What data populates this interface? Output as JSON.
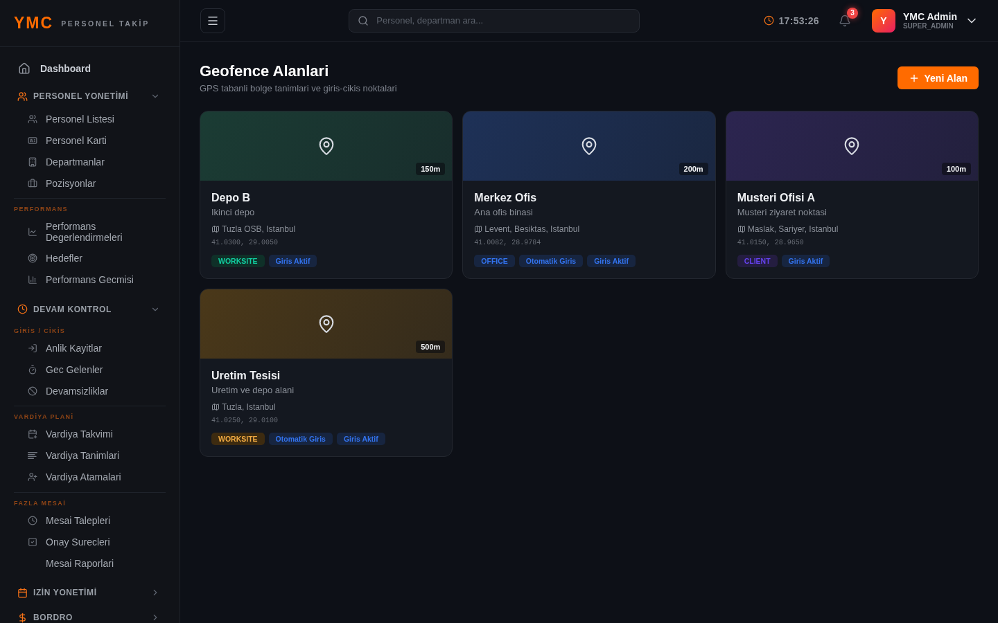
{
  "sidebar": {
    "logo": "YMC",
    "tagline": "PERSONEL TAKİP",
    "nav": [
      {
        "kind": "link",
        "label": "Dashboard"
      },
      {
        "kind": "group",
        "label": "PERSONEL YONETİMİ",
        "expanded": true,
        "sections": [
          {
            "items": [
              "Personel Listesi",
              "Personel Karti",
              "Departmanlar",
              "Pozisyonlar"
            ]
          },
          {
            "title": "PERFORMANS",
            "items": [
              "Performans Degerlendirmeleri",
              "Hedefler",
              "Performans Gecmisi"
            ]
          }
        ]
      },
      {
        "kind": "group",
        "label": "DEVAM KONTROL",
        "expanded": true,
        "sections": [
          {
            "title": "GİRİS / CİKİS",
            "items": [
              "Anlik Kayitlar",
              "Gec Gelenler",
              "Devamsizliklar"
            ]
          },
          {
            "title": "VARDİYA PLANİ",
            "items": [
              "Vardiya Takvimi",
              "Vardiya Tanimlari",
              "Vardiya Atamalari"
            ]
          },
          {
            "title": "FAZLA MESAİ",
            "items": [
              "Mesai Talepleri",
              "Onay Surecleri",
              "Mesai Raporlari"
            ]
          }
        ]
      },
      {
        "kind": "group",
        "label": "IZİN YONETİMİ",
        "expanded": false
      },
      {
        "kind": "group",
        "label": "BORDRO",
        "expanded": false
      }
    ]
  },
  "header": {
    "search": {
      "placeholder": "Personel, departman ara..."
    },
    "clock": "17:53:26",
    "notifications": "3",
    "user": {
      "initial": "Y",
      "name": "YMC Admin",
      "role": "SUPER_ADMIN"
    }
  },
  "page": {
    "title": "Geofence Alanlari",
    "subtitle": "GPS tabanli bolge tanimlari ve giris-cikis noktalari",
    "new_button": "Yeni Alan"
  },
  "geofences": [
    {
      "name": "Depo B",
      "radius": "150m",
      "color": "#1b3c34",
      "description": "Ikinci depo",
      "address": "Tuzla OSB, Istanbul",
      "coordinates": "41.0300, 29.0050",
      "tags": [
        {
          "label": "WORKSITE",
          "color": "#0f3028"
        },
        {
          "label": "Giris Aktif",
          "color": "#172540"
        }
      ]
    },
    {
      "name": "Merkez Ofis",
      "radius": "200m",
      "color": "#1e3157",
      "description": "Ana ofis binasi",
      "address": "Levent, Besiktas, Istanbul",
      "coordinates": "41.0082, 28.9784",
      "tags": [
        {
          "label": "OFFICE",
          "color": "#172540"
        },
        {
          "label": "Otomatik Giris",
          "color": "#172540"
        },
        {
          "label": "Giris Aktif",
          "color": "#172540"
        }
      ]
    },
    {
      "name": "Musteri Ofisi A",
      "radius": "100m",
      "color": "#2c2550",
      "description": "Musteri ziyaret noktasi",
      "address": "Maslak, Sariyer, Istanbul",
      "coordinates": "41.0150, 28.9650",
      "tags": [
        {
          "label": "CLIENT",
          "color": "#241d40"
        },
        {
          "label": "Giris Aktif",
          "color": "#172540"
        }
      ]
    },
    {
      "name": "Uretim Tesisi",
      "radius": "500m",
      "color": "#4a3819",
      "description": "Uretim ve depo alani",
      "address": "Tuzla, Istanbul",
      "coordinates": "41.0250, 29.0100",
      "tags": [
        {
          "label": "WORKSITE",
          "color": "#3d2b10"
        },
        {
          "label": "Otomatik Giris",
          "color": "#172540"
        },
        {
          "label": "Giris Aktif",
          "color": "#172540"
        }
      ]
    }
  ]
}
